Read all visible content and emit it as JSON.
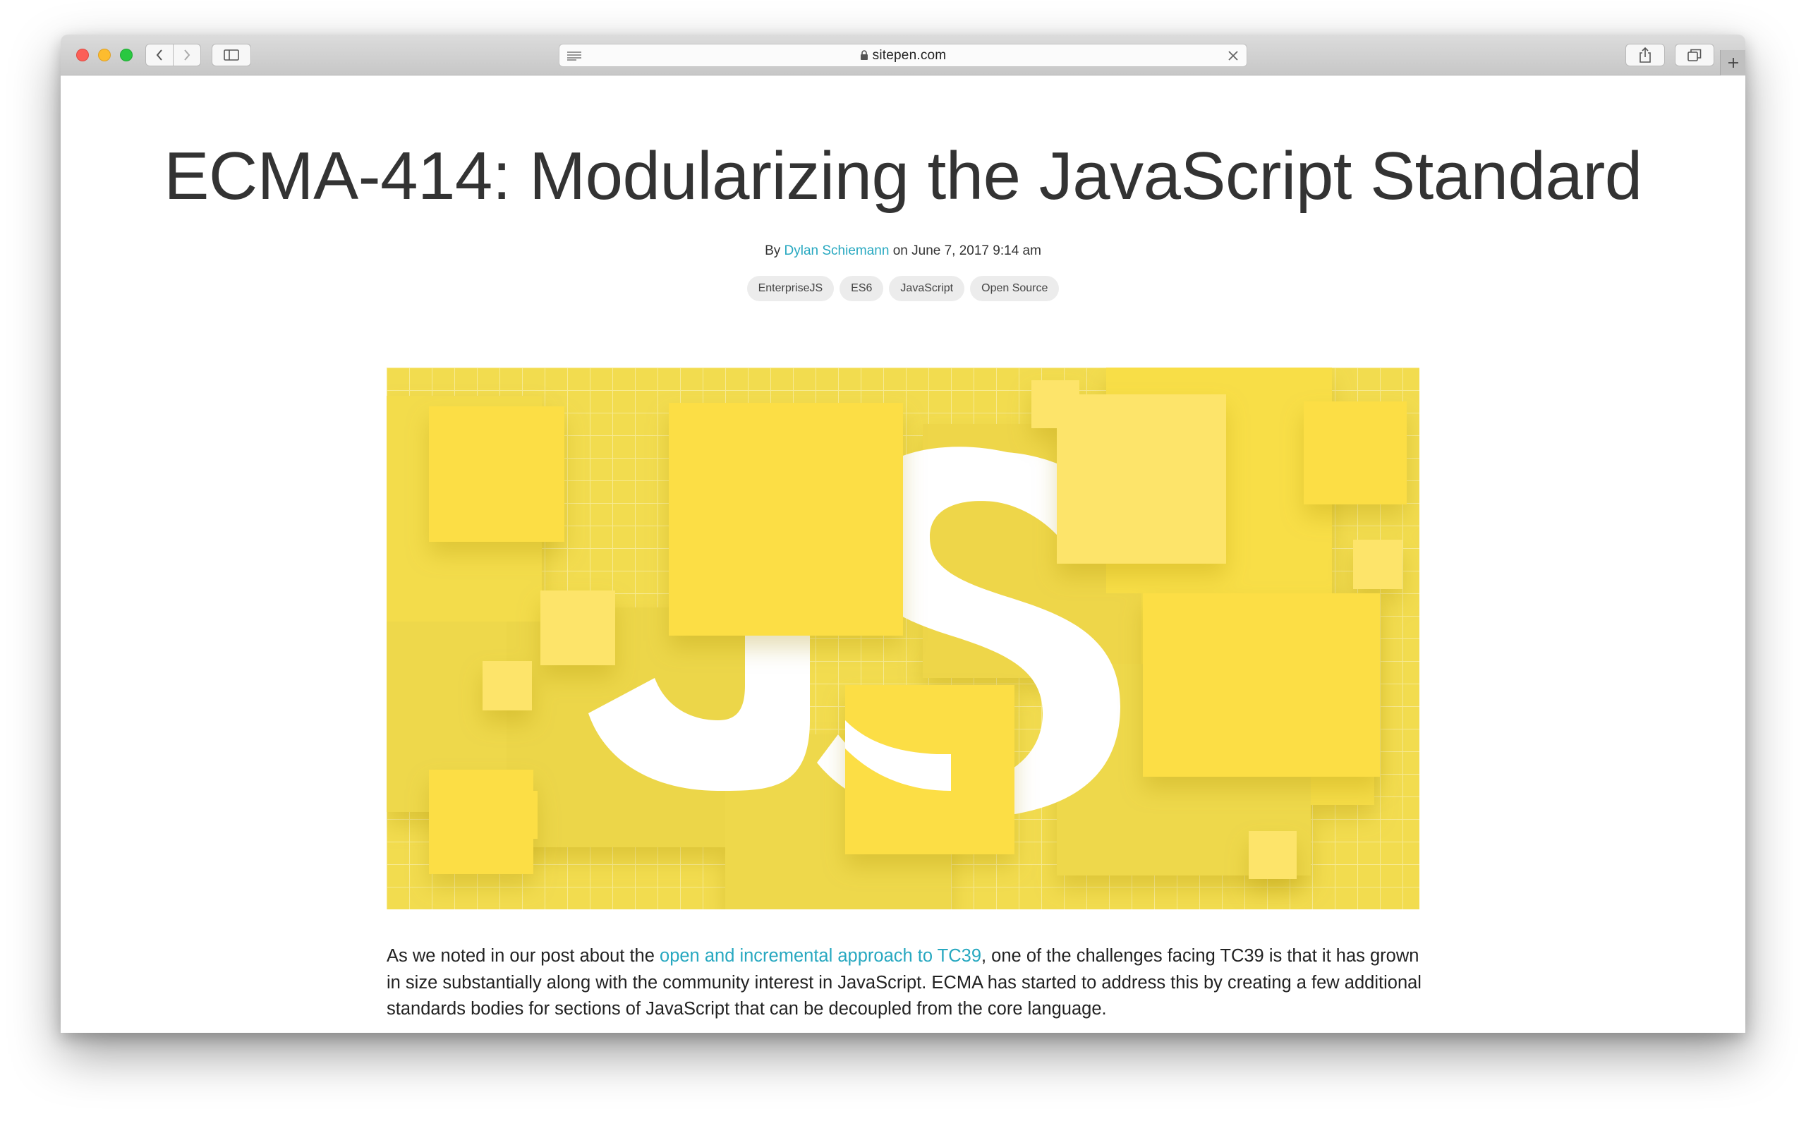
{
  "browser": {
    "url": "sitepen.com",
    "back_icon": "chevron-left-icon",
    "forward_icon": "chevron-right-icon",
    "sidebar_icon": "sidebar-icon",
    "share_icon": "share-icon",
    "tabs_icon": "tabs-overview-icon",
    "new_tab_icon": "plus-icon"
  },
  "article": {
    "title": "ECMA-414: Modularizing the JavaScript Standard",
    "byline_prefix": "By ",
    "author": "Dylan Schiemann",
    "date": " on June 7, 2017 9:14 am",
    "tags": [
      "EnterpriseJS",
      "ES6",
      "JavaScript",
      "Open Source"
    ],
    "hero_text": "JS",
    "body_before_link": "As we noted in our post about the ",
    "body_link": "open and incremental approach to TC39",
    "body_after_link": ", one of the challenges facing TC39 is that it has grown in size substantially along with the community interest in JavaScript. ECMA has started to address this by creating a few additional standards bodies for sections of JavaScript that can be decoupled from the core language."
  },
  "colors": {
    "link": "#27a8c0",
    "hero_yellow": "#f2dc4f",
    "hero_bright": "#fcde44"
  }
}
